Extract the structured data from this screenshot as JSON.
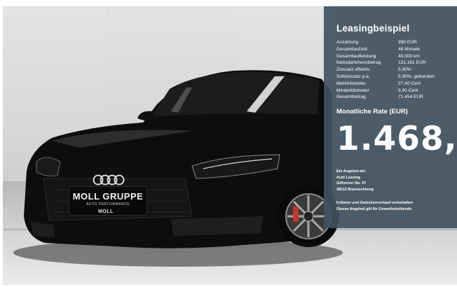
{
  "ad": {
    "plate": {
      "brand": "MOLL GRUPPE",
      "sub": "AUTO PERFORMANCE"
    },
    "grille_logo_text": "MOLL",
    "leasing": {
      "title": "Leasingbeispiel",
      "rows": [
        {
          "label": "Anzahlung",
          "value": "990 EUR"
        },
        {
          "label": "Gesamtlaufzeit",
          "value": "48 Monate"
        },
        {
          "label": "Gesamtlaufleistung",
          "value": "40.000 km"
        },
        {
          "label": "Nettodarlehensbetrag",
          "value": "131.161 EUR"
        },
        {
          "label": "Zinssatz effektiv",
          "value": "5,90%"
        },
        {
          "label": "Sollzinssatz p.a.",
          "value": "5,90%, gebunden"
        },
        {
          "label": "Mehrkilometer",
          "value": "27,40 Cent"
        },
        {
          "label": "Minderkilometer",
          "value": "9,90 Cent"
        },
        {
          "label": "Gesamtbetrag",
          "value": "71.454 EUR"
        }
      ],
      "rate_label": "Monatliche Rate (EUR)",
      "rate_value": "1.468,",
      "offer_lines": [
        "Ein Angebot der",
        "Audi Leasing",
        "Gifhorner Str. 57",
        "38112 Braunschweig"
      ],
      "disclaimer_lines": [
        "Irrtümer und Zwischenverkauf vorbehalten",
        "Dieses Angebot gilt für Gewerbetreibende"
      ]
    },
    "colors": {
      "panel": "#405260",
      "car_body": "#0d0d0d",
      "brake_caliper": "#c0392b"
    }
  }
}
